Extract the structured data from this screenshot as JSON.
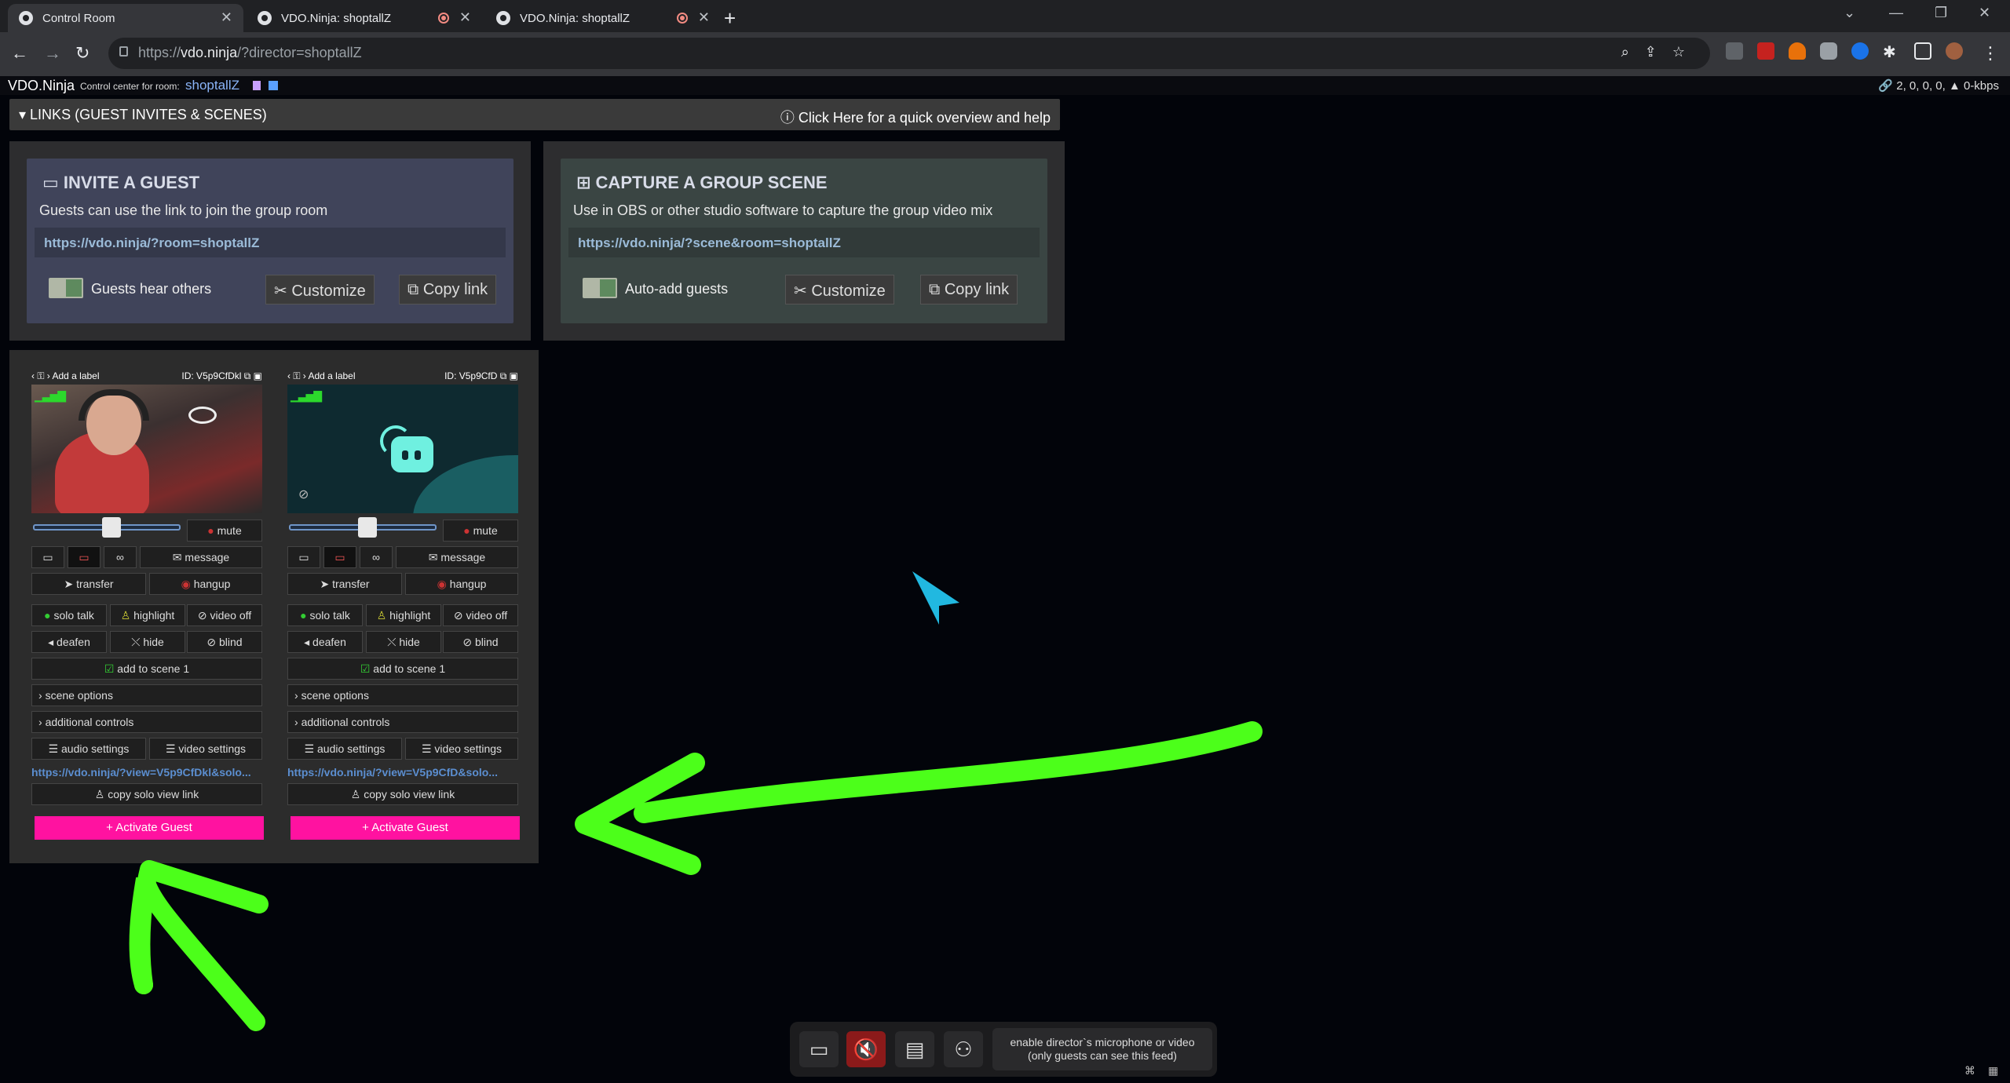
{
  "browser": {
    "tabs": [
      {
        "title": "Control Room",
        "active": true
      },
      {
        "title": "VDO.Ninja: shoptallZ",
        "recording": true
      },
      {
        "title": "VDO.Ninja: shoptallZ",
        "recording": true
      }
    ],
    "url_scheme": "https://",
    "url_host": "vdo.ninja",
    "url_path": "/?director=shoptallZ"
  },
  "topbar": {
    "brand": "VDO.Ninja",
    "control_center": "Control center for room:",
    "room": "shoptallZ",
    "stats": "🔗 2,  0,  0,  0,  ▲ 0-kbps"
  },
  "links_bar": {
    "title": "LINKS (GUEST INVITES & SCENES)",
    "help": "Click Here for a quick overview and help"
  },
  "invite": {
    "title": "INVITE A GUEST",
    "subtitle": "Guests can use the link to join the group room",
    "link": "https://vdo.ninja/?room=shoptallZ",
    "toggle_label": "Guests hear others",
    "customize": "Customize",
    "copy": "Copy link",
    "bg": "#40445a"
  },
  "scene": {
    "title": "CAPTURE A GROUP SCENE",
    "subtitle": "Use in OBS or other studio software to capture the group video mix",
    "link": "https://vdo.ninja/?scene&room=shoptallZ",
    "toggle_label": "Auto-add guests",
    "customize": "Customize",
    "copy": "Copy link",
    "bg": "#3a4543"
  },
  "guests": [
    {
      "label": "Add a label",
      "id": "ID: V5p9CfDkl",
      "mute": "mute",
      "message": "message",
      "transfer": "transfer",
      "hangup": "hangup",
      "solo_talk": "solo talk",
      "highlight": "highlight",
      "video_off": "video off",
      "deafen": "deafen",
      "hide": "hide",
      "blind": "blind",
      "add_scene": "add to scene 1",
      "scene_options": "scene options",
      "additional_controls": "additional controls",
      "audio_settings": "audio settings",
      "video_settings": "video settings",
      "link": "https://vdo.ninja/?view=V5p9CfDkl&solo...",
      "copy_solo": "copy solo view link",
      "activate": "Activate Guest"
    },
    {
      "label": "Add a label",
      "id": "ID: V5p9CfD",
      "mute": "mute",
      "message": "message",
      "transfer": "transfer",
      "hangup": "hangup",
      "solo_talk": "solo talk",
      "highlight": "highlight",
      "video_off": "video off",
      "deafen": "deafen",
      "hide": "hide",
      "blind": "blind",
      "add_scene": "add to scene 1",
      "scene_options": "scene options",
      "additional_controls": "additional controls",
      "audio_settings": "audio settings",
      "video_settings": "video settings",
      "link": "https://vdo.ninja/?view=V5p9CfD&solo...",
      "copy_solo": "copy solo view link",
      "activate": "Activate Guest"
    }
  ],
  "toolbar": {
    "director_line1": "enable director`s microphone or video",
    "director_line2": "(only guests can see this feed)"
  },
  "colors": {
    "activate": "#ff12a0",
    "annotation": "#4cff1a",
    "cursor": "#21b8e0"
  }
}
